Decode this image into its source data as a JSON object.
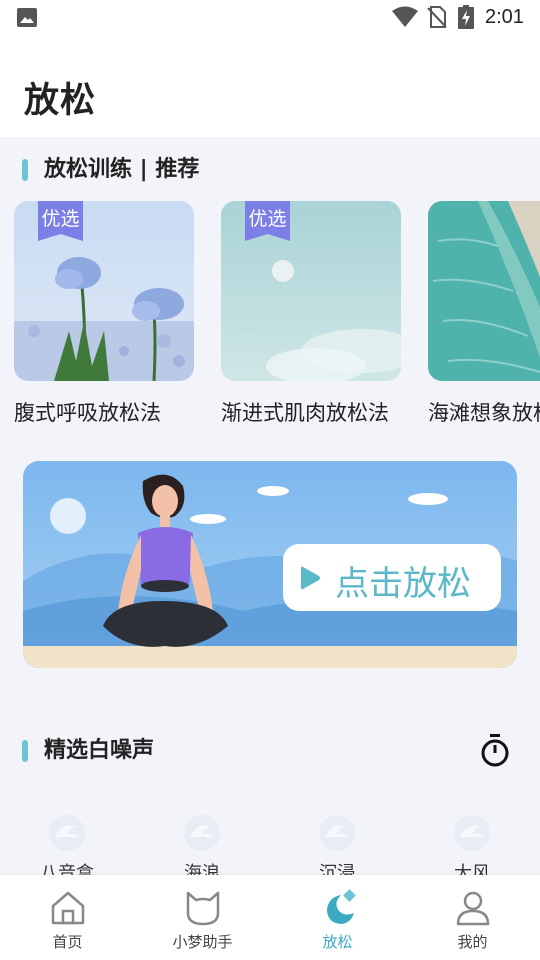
{
  "status_bar": {
    "time": "2:01"
  },
  "page": {
    "title": "放松"
  },
  "training": {
    "header": "放松训练 | 推荐",
    "badge": "优选",
    "cards": [
      {
        "label": "腹式呼吸放松法",
        "badge": "优选"
      },
      {
        "label": "渐进式肌肉放松法",
        "badge": "优选"
      },
      {
        "label": "海滩想象放松法"
      }
    ]
  },
  "banner": {
    "cta": "点击放松"
  },
  "white_noise": {
    "header": "精选白噪声",
    "items": [
      {
        "label": "八音盒"
      },
      {
        "label": "海浪"
      },
      {
        "label": "沉浸"
      },
      {
        "label": "大风"
      }
    ]
  },
  "tab_bar": {
    "active": "放松",
    "items": [
      {
        "label": "首页",
        "icon": "home-icon"
      },
      {
        "label": "小梦助手",
        "icon": "cat-icon"
      },
      {
        "label": "放松",
        "icon": "moon-icon"
      },
      {
        "label": "我的",
        "icon": "user-icon"
      }
    ]
  },
  "colors": {
    "accent": "#3ba8c4",
    "section_bar": "#6cc4d2",
    "badge": "#7b7fe6"
  }
}
